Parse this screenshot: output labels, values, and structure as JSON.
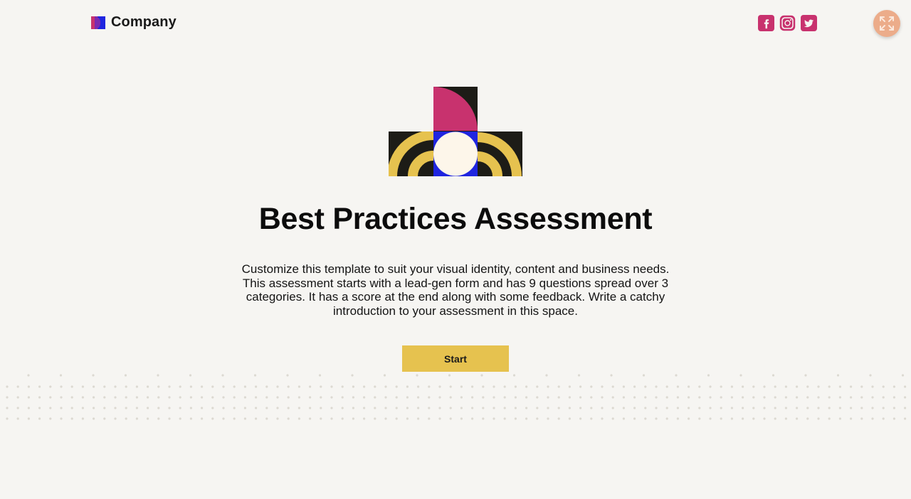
{
  "header": {
    "brand_name": "Company",
    "socials": [
      {
        "icon": "facebook-icon",
        "color": "#c8326e"
      },
      {
        "icon": "instagram-icon",
        "color": "#c8326e"
      },
      {
        "icon": "twitter-icon",
        "color": "#c8326e"
      }
    ],
    "fullscreen_icon": "expand-icon"
  },
  "main": {
    "title": "Best Practices Assessment",
    "intro": "Customize this template to suit your visual identity, content and business needs. This assessment starts with a lead-gen form and has 9 questions spread over 3 categories. It has a score at the end along with some feedback. Write a catchy introduction to your assessment in this space.",
    "start_label": "Start"
  },
  "colors": {
    "background": "#f6f5f2",
    "accent_yellow": "#e6c24f",
    "accent_pink": "#c8326e",
    "accent_blue": "#1f25e0",
    "dark": "#1d1c17",
    "cream": "#fdf6ea",
    "fullscreen_bg": "#ecac8a"
  }
}
